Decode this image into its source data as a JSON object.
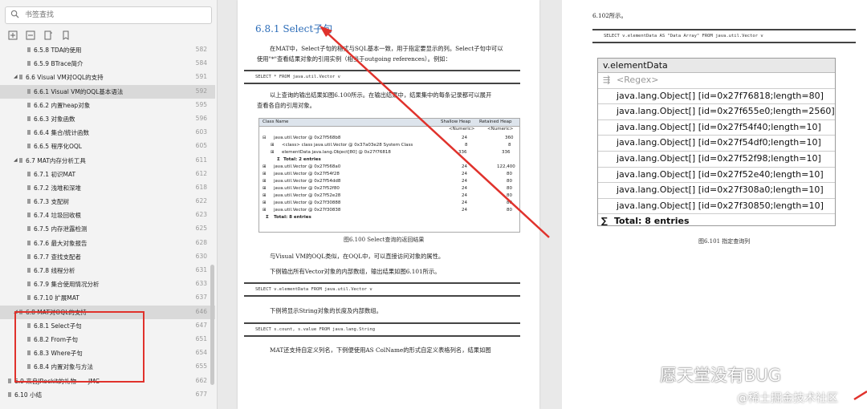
{
  "sidebar": {
    "search_placeholder": "书签查找",
    "items": [
      {
        "label": "6.5.8 TDA的使用",
        "page": "582"
      },
      {
        "label": "6.5.9 BTrace简介",
        "page": "584"
      },
      {
        "label": "6.6 Visual VM对OQL的支持",
        "page": "591"
      },
      {
        "label": "6.6.1 Visual VM的OQL基本语法",
        "page": "592"
      },
      {
        "label": "6.6.2 内置heap对象",
        "page": "595"
      },
      {
        "label": "6.6.3 对象函数",
        "page": "596"
      },
      {
        "label": "6.6.4 集合/统计函数",
        "page": "603"
      },
      {
        "label": "6.6.5 程序化OQL",
        "page": "605"
      },
      {
        "label": "6.7 MAT内存分析工具",
        "page": "611"
      },
      {
        "label": "6.7.1 初识MAT",
        "page": "612"
      },
      {
        "label": "6.7.2 浅堆和深堆",
        "page": "618"
      },
      {
        "label": "6.7.3 支配树",
        "page": "622"
      },
      {
        "label": "6.7.4 垃圾回收根",
        "page": "623"
      },
      {
        "label": "6.7.5 内存泄露检测",
        "page": "625"
      },
      {
        "label": "6.7.6 最大对象报告",
        "page": "628"
      },
      {
        "label": "6.7.7 查找支配者",
        "page": "630"
      },
      {
        "label": "6.7.8 线程分析",
        "page": "631"
      },
      {
        "label": "6.7.9 集合使用情况分析",
        "page": "633"
      },
      {
        "label": "6.7.10 扩展MAT",
        "page": "637"
      },
      {
        "label": "6.8 MAT对OQL的支持",
        "page": "646"
      },
      {
        "label": "6.8.1 Select子句",
        "page": "647"
      },
      {
        "label": "6.8.2 From子句",
        "page": "651"
      },
      {
        "label": "6.8.3 Where子句",
        "page": "654"
      },
      {
        "label": "6.8.4 内置对象与方法",
        "page": "655"
      },
      {
        "label": "6.9 来自JRockit的礼物——JMC",
        "page": "662"
      },
      {
        "label": "6.10 小结",
        "page": "677"
      }
    ]
  },
  "page_left": {
    "heading": "6.8.1    Select子句",
    "para1_l1": "在MAT中，Select子句的格式与SQL基本一致，用于指定要显示的列。Select子句中可以",
    "para1_l2": "使用\"*\"查看结果对象的引用实例（相当于outgoing references）。例如：",
    "code1": "SELECT * FROM java.util.Vector v",
    "para2_l1": "以上查询的输出结果如图6.100所示。在输出结果中，结果集中的每条记录都可以展开",
    "para2_l2": "查看各自的引用对象。",
    "table": {
      "headers": [
        "Class Name",
        "Shallow Heap",
        "Retained Heap"
      ],
      "sub": [
        "<Numeric>",
        "<Numeric>"
      ],
      "rows": [
        {
          "name": "java.util.Vector @ 0x27f568b8",
          "sh": "24",
          "rh": "360"
        },
        {
          "name": "<class> class java.util.Vector @ 0x37a03e28 System Class",
          "sh": "8",
          "rh": "8"
        },
        {
          "name": "elementData java.lang.Object[80] @ 0x27f76818",
          "sh": "336",
          "rh": "336"
        },
        {
          "name": "Total: 2 entries",
          "sh": "",
          "rh": ""
        },
        {
          "name": "java.util.Vector @ 0x27f568a0",
          "sh": "24",
          "rh": "122,400"
        },
        {
          "name": "java.util.Vector @ 0x27f54f28",
          "sh": "24",
          "rh": "80"
        },
        {
          "name": "java.util.Vector @ 0x27f54dd8",
          "sh": "24",
          "rh": "80"
        },
        {
          "name": "java.util.Vector @ 0x27f52f80",
          "sh": "24",
          "rh": "80"
        },
        {
          "name": "java.util.Vector @ 0x27f52e28",
          "sh": "24",
          "rh": "80"
        },
        {
          "name": "java.util.Vector @ 0x27f30888",
          "sh": "24",
          "rh": "80"
        },
        {
          "name": "java.util.Vector @ 0x27f30838",
          "sh": "24",
          "rh": "80"
        },
        {
          "name": "Total: 8 entries",
          "sh": "",
          "rh": ""
        }
      ]
    },
    "caption1": "图6.100    Select查询的返回结果",
    "para3": "与Visual VM的OQL类似，在OQL中，可以直接访问对象的属性。",
    "para4": "下例输出所有Vector对象的内部数组，输出结果如图6.101所示。",
    "code2": "SELECT v.elementData FROM java.util.Vector v",
    "para5": "下例将显示String对象的长度及内部数组。",
    "code3": "SELECT s.count, s.value FROM java.lang.String",
    "para6": "MAT还支持自定义列名，下例便使用AS ColName的形式自定义表格列名，结果如图"
  },
  "page_right": {
    "top_text": "6.102所示。",
    "code": "SELECT v.elementData AS \"Data Array\" FROM java.util.Vector v",
    "header": "v.elementData",
    "regex": "<Regex>",
    "rows": [
      "java.lang.Object[] [id=0x27f76818;length=80]",
      "java.lang.Object[] [id=0x27f655e0;length=2560]",
      "java.lang.Object[] [id=0x27f54f40;length=10]",
      "java.lang.Object[] [id=0x27f54df0;length=10]",
      "java.lang.Object[] [id=0x27f52f98;length=10]",
      "java.lang.Object[] [id=0x27f52e40;length=10]",
      "java.lang.Object[] [id=0x27f308a0;length=10]",
      "java.lang.Object[] [id=0x27f30850;length=10]"
    ],
    "total": "Total: 8 entries",
    "caption": "图6.101    指定查询列"
  },
  "watermark": {
    "line1": "愿天堂没有BUG",
    "line2": "@稀土掘金技术社区"
  },
  "colors": {
    "accent": "#2b6cb8",
    "highlight_box": "#e0322c"
  }
}
